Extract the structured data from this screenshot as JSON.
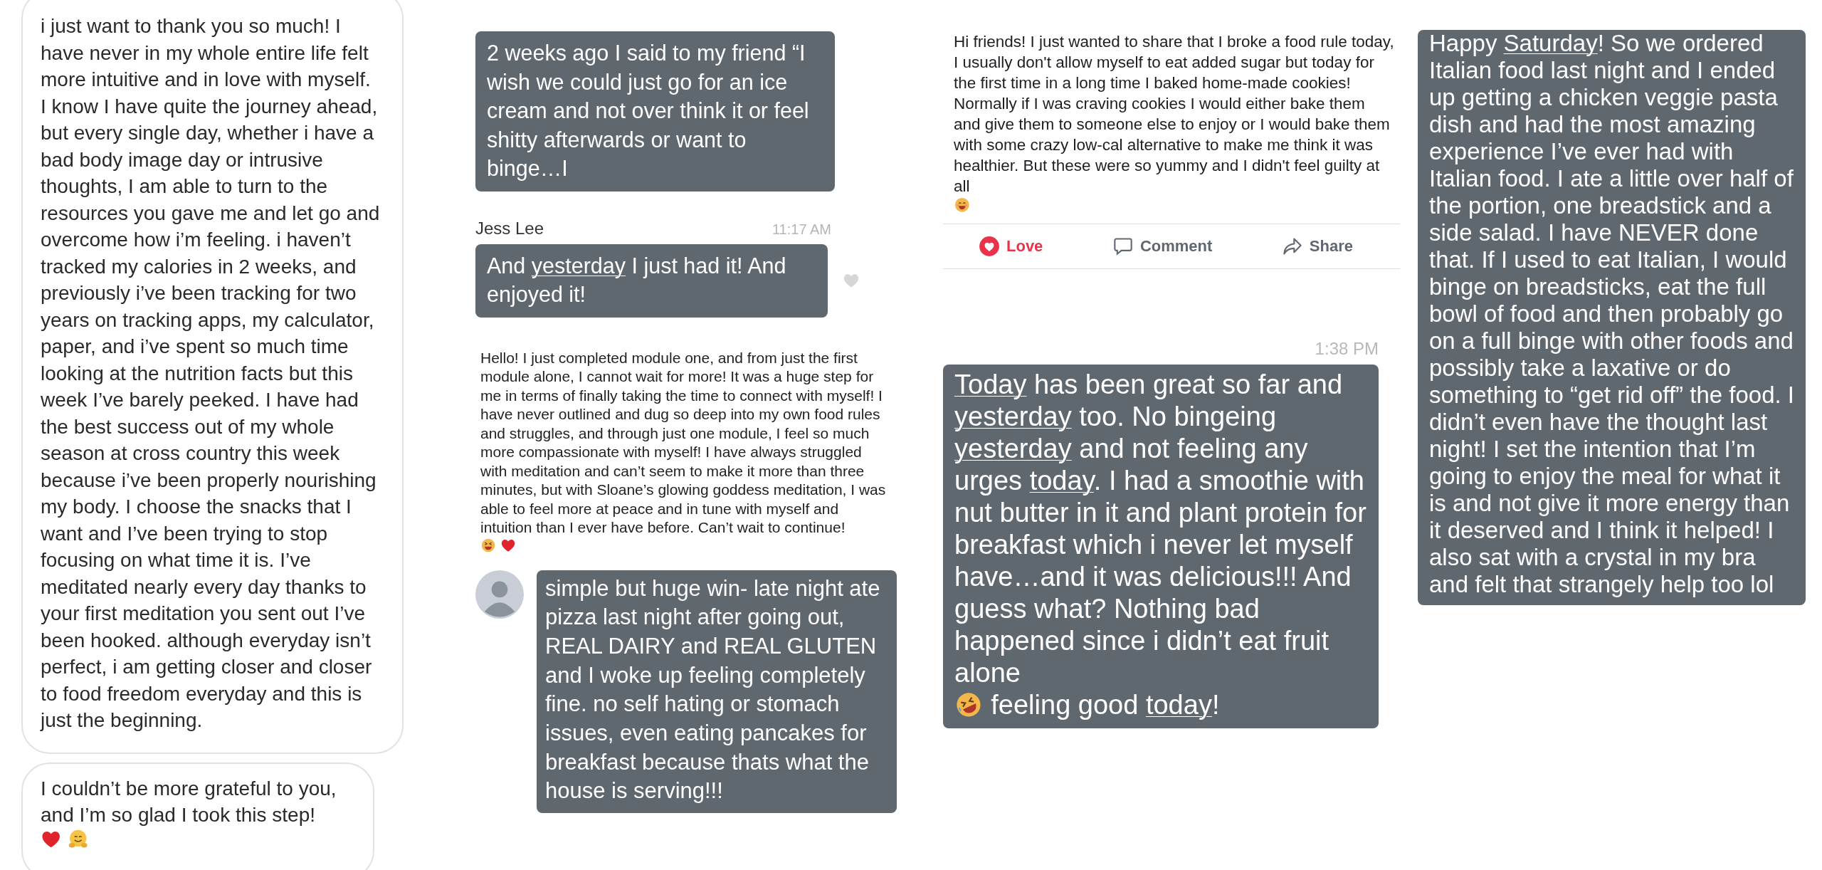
{
  "columns": [
    {
      "items": [
        {
          "kind": "light-bubble",
          "segments": [
            {
              "text": "i just want to thank you so much! I have never in my whole entire life felt more intuitive and in love with myself. I know I have quite the journey ahead, but every single day, whether i have a bad body image day or intrusive thoughts, I am able to turn to the resources you gave me and let go and overcome how i’m feeling. i haven’t tracked my calories in 2 weeks, and previously i’ve been tracking for two years on tracking apps, my calculator, paper, and i’ve spent so much time looking at the nutrition facts but this week I’ve barely peeked. I have had the best success out of my whole season at cross country this week because i’ve been properly nourishing my body. I choose the snacks that I want and I’ve been trying to stop focusing on what time it is. I’ve meditated nearly every day thanks to your first meditation you sent out I’ve been hooked. although everyday isn’t perfect, i am getting closer and closer to food freedom everyday and this is just the beginning.",
              "underlined": false
            }
          ]
        },
        {
          "kind": "light-bubble",
          "segments": [
            {
              "text": "I couldn’t be more grateful to you, and I’m so glad I took this step!",
              "underlined": false
            },
            {
              "kind": "heart"
            },
            {
              "kind": "hug"
            }
          ]
        }
      ]
    },
    {
      "items": [
        {
          "kind": "dark-bubble",
          "heart": false,
          "avatar": false,
          "segments": [
            {
              "text": "2 weeks ago I said to my friend “I wish we could just go for an ice cream and not over think it or feel shitty afterwards or want to binge…I",
              "underlined": false
            }
          ]
        },
        {
          "kind": "sender-line",
          "name": "Jess Lee",
          "time": "11:17 AM"
        },
        {
          "kind": "dark-bubble",
          "heart": true,
          "avatar": false,
          "segments": [
            {
              "text": "And ",
              "underlined": false
            },
            {
              "text": "yesterday",
              "underlined": true
            },
            {
              "text": " I just had it! And enjoyed it!",
              "underlined": false
            }
          ]
        },
        {
          "kind": "plain-text",
          "segments": [
            {
              "text": "Hello! I just completed module one, and from just the first module alone, I cannot wait for more! It was a huge step for me in terms of finally taking the time to connect with myself! I have never outlined and dug so deep into my own food rules and struggles, and through just one module, I feel so much more compassionate with myself! I have always struggled with meditation and can’t seem to make it more than three minutes, but with Sloane’s glowing goddess meditation, I was able to feel more at peace and in tune with myself and intuition than I ever have before. Can’t wait to continue!",
              "underlined": false
            },
            {
              "kind": "grin"
            },
            {
              "kind": "heart"
            }
          ]
        },
        {
          "kind": "dark-bubble",
          "heart": false,
          "avatar": true,
          "segments": [
            {
              "text": "simple but huge win- late night ate pizza last night after going out, REAL DAIRY and REAL GLUTEN and I woke up feeling completely fine. no self hating or stomach issues, even eating pancakes for breakfast because thats what the house is serving!!!",
              "underlined": false
            }
          ]
        }
      ]
    },
    {
      "items": [
        {
          "kind": "post",
          "segments": [
            {
              "text": "Hi friends! I just wanted to share that I broke a food rule today, I usually don't allow myself to eat added sugar but today for the first time in a long time I baked home-made cookies! Normally if I was craving cookies I would either bake them and give them to someone else to enjoy or I would bake them with some crazy low-cal alternative to make me think it was healthier. But these were so yummy and I didn't feel guilty at all",
              "underlined": false
            },
            {
              "kind": "smile"
            }
          ],
          "actions": [
            {
              "kind": "love",
              "label": "Love",
              "selected": true
            },
            {
              "kind": "comment",
              "label": "Comment",
              "selected": false
            },
            {
              "kind": "share",
              "label": "Share",
              "selected": false
            }
          ]
        },
        {
          "kind": "time",
          "time": "1:38 PM"
        },
        {
          "kind": "dark-bubble",
          "heart": false,
          "avatar": false,
          "segments": [
            {
              "text": "Today",
              "underlined": true
            },
            {
              "text": " has been great so far and ",
              "underlined": false
            },
            {
              "text": "yesterday",
              "underlined": true
            },
            {
              "text": " too. No bingeing ",
              "underlined": false
            },
            {
              "text": "yesterday",
              "underlined": true
            },
            {
              "text": " and not feeling any urges ",
              "underlined": false
            },
            {
              "text": "today",
              "underlined": true
            },
            {
              "text": ". I had a smoothie with nut butter in it and plant protein for breakfast which i never let myself have…and it was delicious!!! And guess what? Nothing bad happened since i didn’t eat fruit alone",
              "underlined": false
            },
            {
              "kind": "rofl"
            },
            {
              "text": "feeling good ",
              "underlined": false
            },
            {
              "text": "today",
              "underlined": true
            },
            {
              "text": "!",
              "underlined": false
            }
          ]
        }
      ]
    },
    {
      "items": [
        {
          "kind": "dark-bubble",
          "heart": false,
          "avatar": false,
          "segments": [
            {
              "text": "Happy ",
              "underlined": false
            },
            {
              "text": "Saturday",
              "underlined": true
            },
            {
              "text": "! So we ordered Italian food last night and I ended up getting a chicken veggie pasta dish and had the most amazing experience I’ve ever had with Italian food. I ate a little over half of the portion, one breadstick and a side salad. I have NEVER done that. If I used to eat Italian, I would binge on breadsticks, eat the full bowl of food and then probably go on a full binge with other foods and possibly take a laxative or do something to “get rid off” the food. I didn’t even have the thought last night! I set the intention that I’m going to enjoy the meal for what it is and not give it more energy than it deserved and I think it helped! I also sat with a crystal in my bra and felt that strangely help too lol",
              "underlined": false
            }
          ]
        }
      ]
    }
  ]
}
